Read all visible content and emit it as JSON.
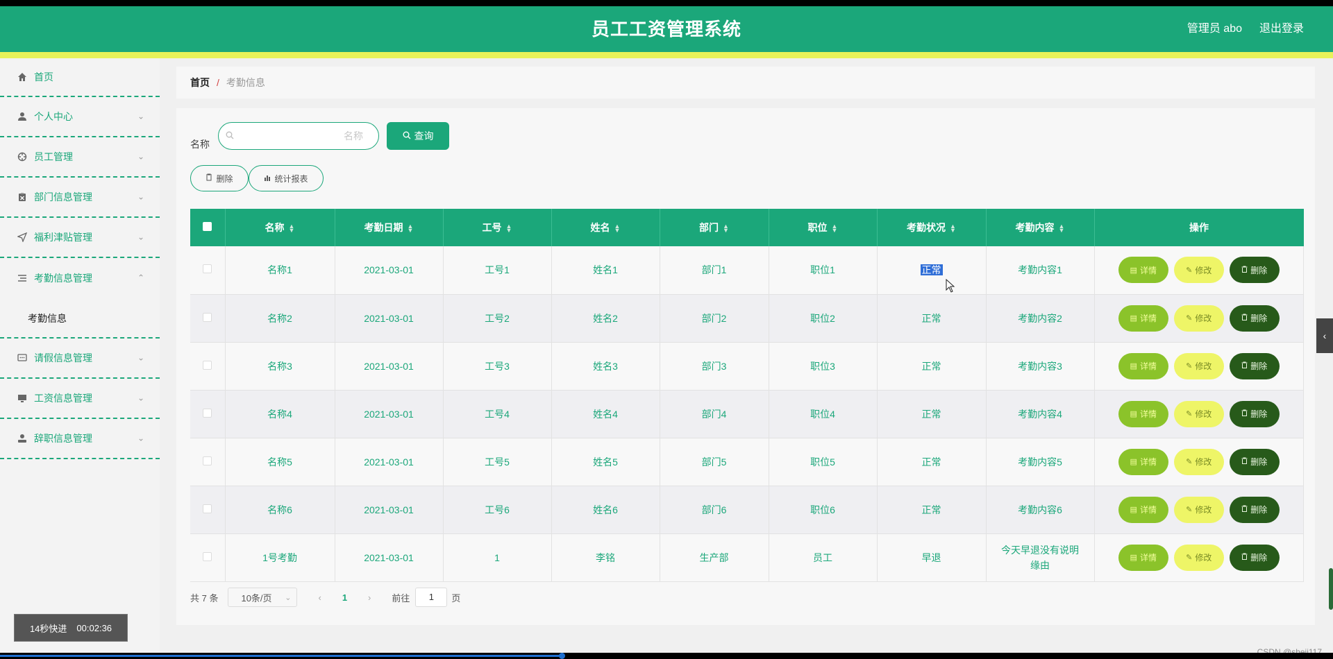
{
  "header": {
    "title": "员工工资管理系统",
    "user_label": "管理员 abo",
    "logout_label": "退出登录"
  },
  "sidebar": {
    "items": [
      {
        "label": "首页",
        "icon": "home-icon"
      },
      {
        "label": "个人中心",
        "icon": "user-icon"
      },
      {
        "label": "员工管理",
        "icon": "crosshair-icon"
      },
      {
        "label": "部门信息管理",
        "icon": "clipboard-icon"
      },
      {
        "label": "福利津贴管理",
        "icon": "send-icon"
      },
      {
        "label": "考勤信息管理",
        "icon": "list-icon"
      },
      {
        "label": "请假信息管理",
        "icon": "chat-icon"
      },
      {
        "label": "工资信息管理",
        "icon": "monitor-icon"
      },
      {
        "label": "辞职信息管理",
        "icon": "person-icon"
      }
    ],
    "sub_item": "考勤信息"
  },
  "breadcrumb": {
    "home": "首页",
    "separator": "/",
    "current": "考勤信息"
  },
  "search": {
    "label": "名称",
    "placeholder": "名称",
    "button": "查询"
  },
  "actions": {
    "delete": "删除",
    "report": "统计报表"
  },
  "table": {
    "headers": [
      "名称",
      "考勤日期",
      "工号",
      "姓名",
      "部门",
      "职位",
      "考勤状况",
      "考勤内容",
      "操作"
    ],
    "rows": [
      {
        "name": "名称1",
        "date": "2021-03-01",
        "id": "工号1",
        "person": "姓名1",
        "dept": "部门1",
        "position": "职位1",
        "status": "正常",
        "content": "考勤内容1"
      },
      {
        "name": "名称2",
        "date": "2021-03-01",
        "id": "工号2",
        "person": "姓名2",
        "dept": "部门2",
        "position": "职位2",
        "status": "正常",
        "content": "考勤内容2"
      },
      {
        "name": "名称3",
        "date": "2021-03-01",
        "id": "工号3",
        "person": "姓名3",
        "dept": "部门3",
        "position": "职位3",
        "status": "正常",
        "content": "考勤内容3"
      },
      {
        "name": "名称4",
        "date": "2021-03-01",
        "id": "工号4",
        "person": "姓名4",
        "dept": "部门4",
        "position": "职位4",
        "status": "正常",
        "content": "考勤内容4"
      },
      {
        "name": "名称5",
        "date": "2021-03-01",
        "id": "工号5",
        "person": "姓名5",
        "dept": "部门5",
        "position": "职位5",
        "status": "正常",
        "content": "考勤内容5"
      },
      {
        "name": "名称6",
        "date": "2021-03-01",
        "id": "工号6",
        "person": "姓名6",
        "dept": "部门6",
        "position": "职位6",
        "status": "正常",
        "content": "考勤内容6"
      },
      {
        "name": "1号考勤",
        "date": "2021-03-01",
        "id": "1",
        "person": "李铭",
        "dept": "生产部",
        "position": "员工",
        "status": "早退",
        "content": "今天早退没有说明缘由"
      }
    ],
    "op_labels": {
      "detail": "详情",
      "edit": "修改",
      "delete": "删除"
    }
  },
  "pagination": {
    "total": "共 7 条",
    "page_size": "10条/页",
    "current_page": "1",
    "goto_label": "前往",
    "goto_value": "1",
    "page_unit": "页"
  },
  "overlay": {
    "speed_label": "14秒快进",
    "time": "00:02:36",
    "watermark": "CSDN @sheji117"
  },
  "colors": {
    "primary": "#1ba77a",
    "accent_bar": "#e7f25a",
    "detail": "#8bc32a",
    "edit": "#eef567",
    "delete": "#275a1a"
  }
}
